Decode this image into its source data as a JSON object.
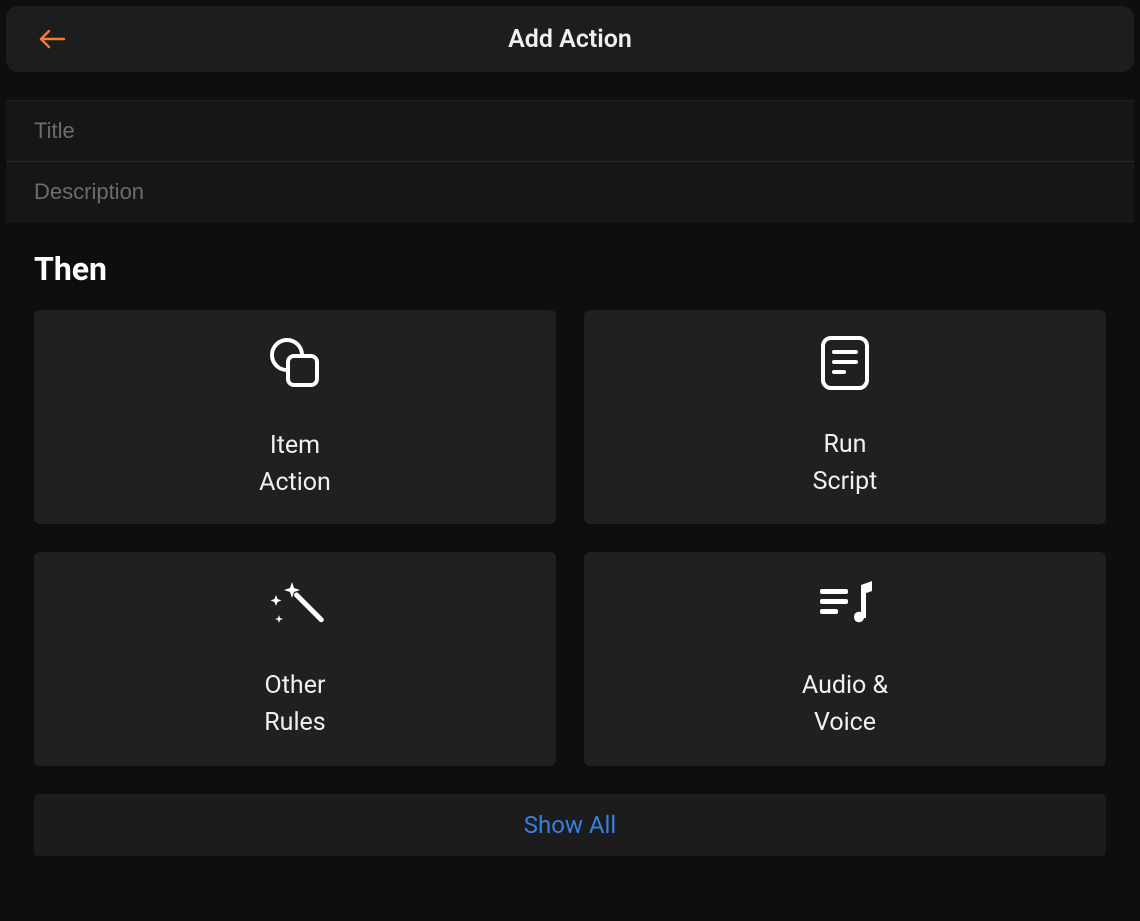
{
  "header": {
    "title": "Add Action"
  },
  "inputs": {
    "title_placeholder": "Title",
    "description_placeholder": "Description"
  },
  "section_label": "Then",
  "cards": [
    {
      "label": "Item\nAction"
    },
    {
      "label": "Run\nScript"
    },
    {
      "label": "Other\nRules"
    },
    {
      "label": "Audio &\nVoice"
    }
  ],
  "show_all_label": "Show All"
}
